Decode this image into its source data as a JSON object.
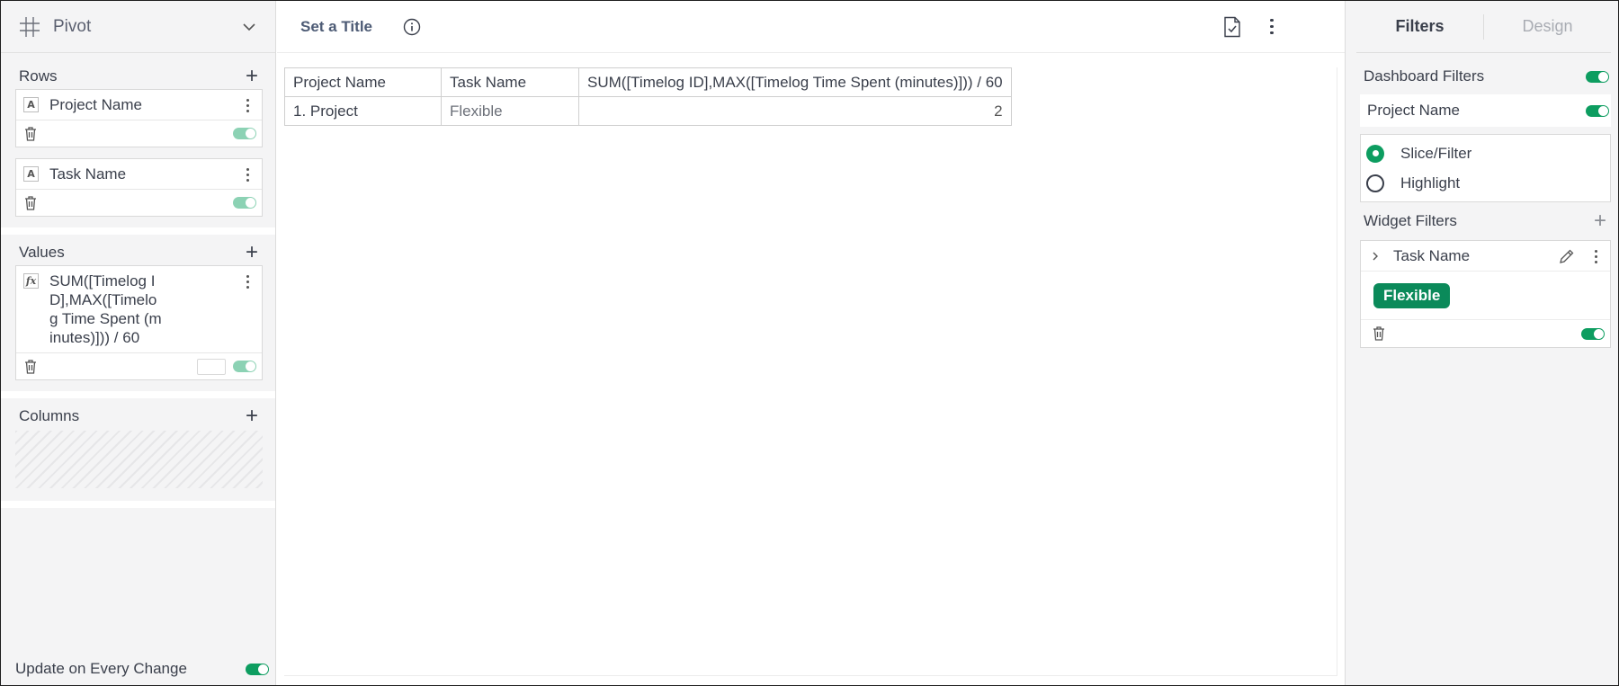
{
  "left_panel": {
    "widget_type": "Pivot",
    "rows_title": "Rows",
    "rows": [
      {
        "type_badge": "A",
        "label": "Project Name"
      },
      {
        "type_badge": "A",
        "label": "Task Name"
      }
    ],
    "values_title": "Values",
    "values": [
      {
        "type_badge": "fx",
        "label": "SUM([Timelog ID],MAX([Timelog Time Spent (minutes)])) / 60"
      }
    ],
    "columns_title": "Columns",
    "update_label": "Update on Every Change"
  },
  "center": {
    "title": "Set a Title",
    "table": {
      "headers": [
        "Project Name",
        "Task Name",
        "SUM([Timelog ID],MAX([Timelog Time Spent (minutes)])) / 60"
      ],
      "rows": [
        [
          "1. Project",
          "Flexible",
          "2"
        ]
      ]
    }
  },
  "right_panel": {
    "tabs": [
      {
        "label": "Filters",
        "active": true
      },
      {
        "label": "Design",
        "active": false
      }
    ],
    "dashboard_filters_label": "Dashboard Filters",
    "dashboard_filter": {
      "name": "Project Name",
      "options": [
        {
          "label": "Slice/Filter",
          "selected": true
        },
        {
          "label": "Highlight",
          "selected": false
        }
      ]
    },
    "widget_filters_label": "Widget Filters",
    "widget_filter": {
      "name": "Task Name",
      "chip": "Flexible"
    }
  },
  "colors": {
    "accent_green": "#0d9d60",
    "chip_green": "#0b8a5a",
    "title_text": "#4d5b75"
  }
}
